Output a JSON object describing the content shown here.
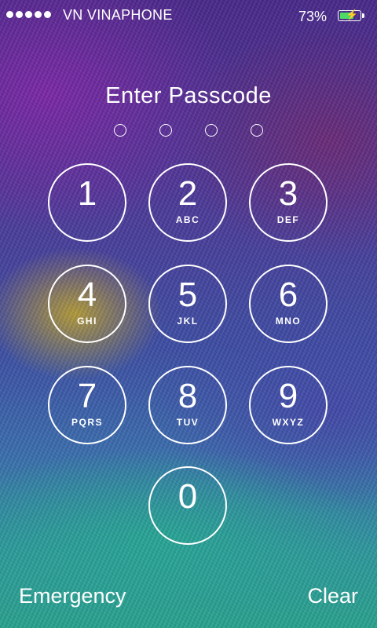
{
  "status_bar": {
    "carrier": "VN VINAPHONE",
    "battery_percent": "73%",
    "battery_color": "#4cd964",
    "battery_level": 0.73,
    "icons": [
      "signal-dots-icon",
      "battery-charging-icon"
    ]
  },
  "lock_screen": {
    "title": "Enter Passcode",
    "entered_digits": 0,
    "keys": [
      {
        "digit": "1",
        "letters": ""
      },
      {
        "digit": "2",
        "letters": "ABC"
      },
      {
        "digit": "3",
        "letters": "DEF"
      },
      {
        "digit": "4",
        "letters": "GHI"
      },
      {
        "digit": "5",
        "letters": "JKL"
      },
      {
        "digit": "6",
        "letters": "MNO"
      },
      {
        "digit": "7",
        "letters": "PQRS"
      },
      {
        "digit": "8",
        "letters": "TUV"
      },
      {
        "digit": "9",
        "letters": "WXYZ"
      },
      {
        "digit": "0",
        "letters": ""
      }
    ],
    "emergency_label": "Emergency",
    "clear_label": "Clear"
  }
}
